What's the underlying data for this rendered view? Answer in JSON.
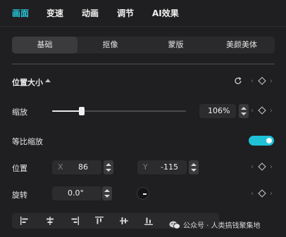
{
  "top_tabs": [
    {
      "label": "画面",
      "active": true
    },
    {
      "label": "变速",
      "active": false
    },
    {
      "label": "动画",
      "active": false
    },
    {
      "label": "调节",
      "active": false
    },
    {
      "label": "AI效果",
      "active": false
    }
  ],
  "segment_tabs": [
    {
      "label": "基础",
      "active": true
    },
    {
      "label": "抠像",
      "active": false
    },
    {
      "label": "蒙版",
      "active": false
    },
    {
      "label": "美颜美体",
      "active": false
    }
  ],
  "position_size": {
    "title": "位置大小",
    "scale": {
      "label": "缩放",
      "value": "106%",
      "slider_fraction": 0.22
    },
    "uniform_scale": {
      "label": "等比缩放",
      "enabled": true
    },
    "position": {
      "label": "位置",
      "x_prefix": "X",
      "x_value": "86",
      "y_prefix": "Y",
      "y_value": "-115"
    },
    "rotation": {
      "label": "旋转",
      "value": "0.0°"
    }
  },
  "keyframe_chevrons": {
    "left": "‹",
    "right": "›"
  },
  "watermark": {
    "text": "公众号 · 人类搞钱聚集地"
  },
  "colors": {
    "accent": "#26c6da",
    "toggle": "#1fc1d6",
    "background": "#1f1f21"
  },
  "icons": [
    "reset-icon",
    "keyframe-diamond-icon",
    "rotation-dial-icon",
    "align-left-icon",
    "align-center-h-icon",
    "align-right-icon",
    "align-top-icon",
    "align-center-v-icon",
    "align-bottom-icon",
    "wechat-icon"
  ]
}
